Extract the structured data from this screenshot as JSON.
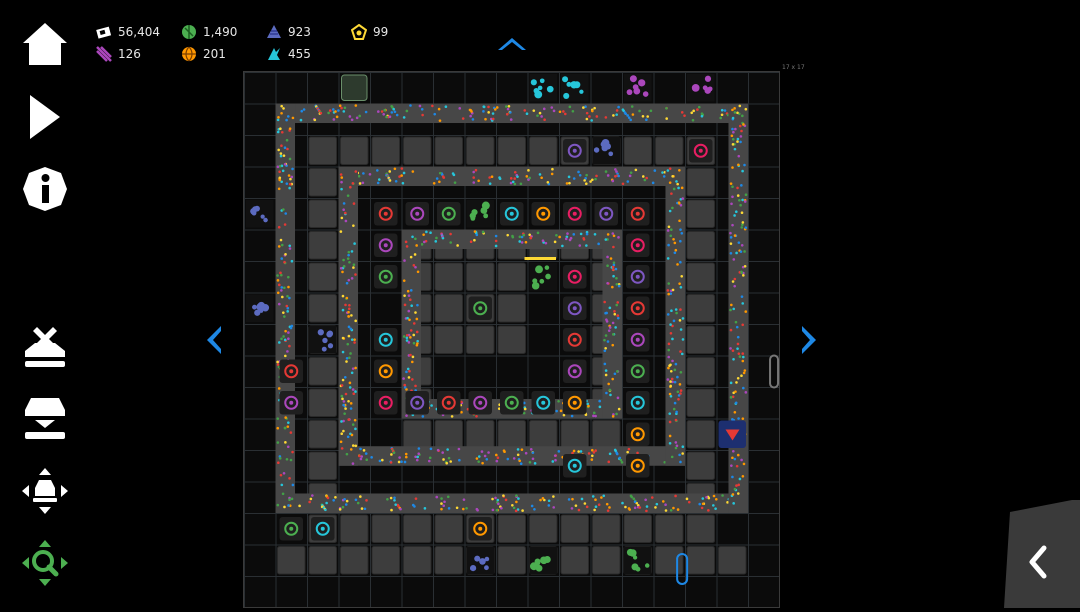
{
  "resources": [
    {
      "id": "credits",
      "value": "56,404",
      "color": "#ffffff",
      "icon": "banknote-icon"
    },
    {
      "id": "green",
      "value": "1,490",
      "color": "#4caf50",
      "icon": "green-crystal-icon"
    },
    {
      "id": "blue",
      "value": "923",
      "color": "#5c6bc0",
      "icon": "blue-shards-icon"
    },
    {
      "id": "yellow",
      "value": "99",
      "color": "#fdd835",
      "icon": "yellow-gem-icon"
    },
    {
      "id": "purple",
      "value": "126",
      "color": "#ab47bc",
      "icon": "purple-slashes-icon"
    },
    {
      "id": "orange",
      "value": "201",
      "color": "#ff9800",
      "icon": "orange-ball-icon"
    },
    {
      "id": "cyan",
      "value": "455",
      "color": "#26c6da",
      "icon": "cyan-shards-icon"
    }
  ],
  "sidebar": [
    {
      "id": "home",
      "icon": "home-icon"
    },
    {
      "id": "play",
      "icon": "play-icon"
    },
    {
      "id": "info",
      "icon": "info-icon"
    },
    {
      "id": "remove",
      "icon": "demolish-icon"
    },
    {
      "id": "place",
      "icon": "build-icon"
    },
    {
      "id": "move",
      "icon": "move-icon"
    },
    {
      "id": "zoom",
      "icon": "zoom-move-icon",
      "color": "#4caf50"
    }
  ],
  "board": {
    "size_label": "17 x 17",
    "cols": 17,
    "rows": 17
  },
  "colors": {
    "accent": "#1e88e5",
    "tile": "#3b3b3b",
    "conveyor": "#464646"
  }
}
